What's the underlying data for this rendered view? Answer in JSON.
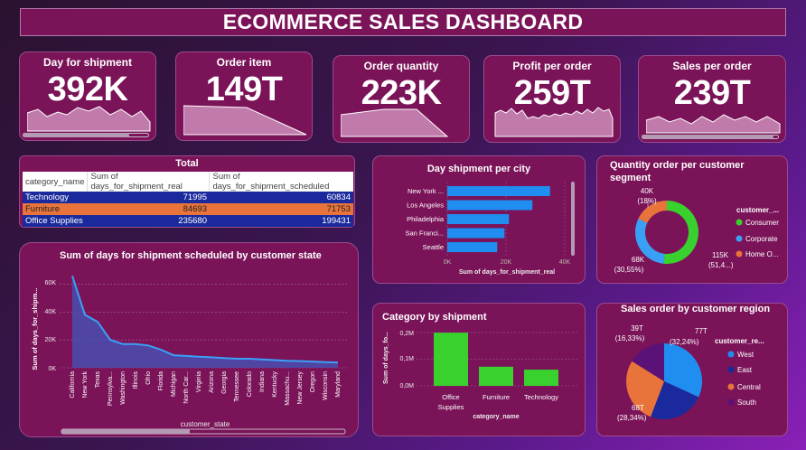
{
  "dashboard": {
    "title": "ECOMMERCE SALES DASHBOARD"
  },
  "kpis": [
    {
      "label": "Day for shipment",
      "value": "392K"
    },
    {
      "label": "Order item",
      "value": "149T"
    },
    {
      "label": "Order quantity",
      "value": "223K"
    },
    {
      "label": "Profit per order",
      "value": "259T"
    },
    {
      "label": "Sales per order",
      "value": "239T"
    }
  ],
  "table": {
    "title": "Total",
    "headers": [
      "category_name",
      "Sum of days_for_shipment_real",
      "Sum of days_for_shipment_scheduled"
    ],
    "rows": [
      {
        "category": "Technology",
        "real": "71995",
        "scheduled": "60834",
        "color": "#1a2a9c"
      },
      {
        "category": "Furniture",
        "real": "84693",
        "scheduled": "71753",
        "color": "#e8743b"
      },
      {
        "category": "Office Supplies",
        "real": "235680",
        "scheduled": "199431",
        "color": "#1a2a9c"
      }
    ]
  },
  "day_shipment_city": {
    "title": "Day shipment per city",
    "ylabel": "customer_city",
    "xlabel": "Sum of days_for_shipment_real",
    "x_ticks": [
      "0K",
      "20K",
      "40K"
    ]
  },
  "segment_donut": {
    "title_line1": "Quantity order per customer",
    "title_line2": "segment",
    "legend_title": "customer_...",
    "labels": {
      "top": "40K",
      "top_pct": "(18%)",
      "left": "68K",
      "left_pct": "(30,55%)",
      "right": "115K",
      "right_pct": "(51,4...)"
    },
    "legend": [
      {
        "name": "Consumer",
        "color": "#39d12e"
      },
      {
        "name": "Corporate",
        "color": "#3aa0f5"
      },
      {
        "name": "Home O...",
        "color": "#e8743b"
      }
    ]
  },
  "state_chart": {
    "title": "Sum of days for shipment scheduled by customer state",
    "ylabel": "Sum of days_for_shipm...",
    "xlabel": "customer_state",
    "y_ticks": [
      "60K",
      "40K",
      "20K",
      "0K"
    ]
  },
  "category_shipment": {
    "title": "Category by shipment",
    "ylabel": "Sum of days_fo...",
    "xlabel": "category_name",
    "y_ticks": [
      "0,2M",
      "0,1M",
      "0,0M"
    ],
    "cat_labels": [
      "Office",
      "Supplies",
      "Furniture",
      "Technology"
    ]
  },
  "region_pie": {
    "title": "Sales order by customer region",
    "legend_title": "customer_re...",
    "labels": {
      "tl": "39T",
      "tl_pct": "(16,33%)",
      "tr": "77T",
      "tr_pct": "(32,24%)",
      "bl": "68T",
      "bl_pct": "(28,34%)"
    },
    "legend": [
      {
        "name": "West",
        "color": "#1f8ef0"
      },
      {
        "name": "East",
        "color": "#1a2a9c"
      },
      {
        "name": "Central",
        "color": "#e8743b"
      },
      {
        "name": "South",
        "color": "#5a1278"
      }
    ]
  },
  "chart_data": [
    {
      "type": "bar",
      "title": "Day shipment per city",
      "xlabel": "Sum of days_for_shipment_real",
      "ylabel": "customer_city",
      "categories": [
        "New York ...",
        "Los Angeles",
        "Philadelphia",
        "San Franci...",
        "Seattle"
      ],
      "values": [
        35000,
        29000,
        21000,
        19500,
        17000
      ],
      "xlim": [
        0,
        40000
      ]
    },
    {
      "type": "pie",
      "title": "Quantity order per customer segment",
      "categories": [
        "Consumer",
        "Corporate",
        "Home O..."
      ],
      "values": [
        115,
        68,
        40
      ],
      "percents": [
        51.4,
        30.55,
        18
      ]
    },
    {
      "type": "area",
      "title": "Sum of days for shipment scheduled by customer state",
      "xlabel": "customer_state",
      "ylabel": "Sum of days_for_shipm...",
      "categories": [
        "California",
        "New York",
        "Texas",
        "Pennsylva...",
        "Washington",
        "Illinois",
        "Ohio",
        "Florida",
        "Michigan",
        "North Car...",
        "Virginia",
        "Arizona",
        "Georgia",
        "Tennessee",
        "Colorado",
        "Indiana",
        "Kentucky",
        "Massachu...",
        "New Jersey",
        "Oregon",
        "Wisconsin",
        "Maryland"
      ],
      "values": [
        66000,
        38000,
        33000,
        20000,
        17000,
        17000,
        16000,
        13000,
        9000,
        8500,
        8000,
        7500,
        7000,
        6500,
        6500,
        6000,
        5500,
        5000,
        4800,
        4500,
        4000,
        3800
      ],
      "ylim": [
        0,
        70000
      ]
    },
    {
      "type": "bar",
      "title": "Category by shipment",
      "xlabel": "category_name",
      "ylabel": "Sum of days_fo...",
      "categories": [
        "Office Supplies",
        "Furniture",
        "Technology"
      ],
      "values": [
        199431,
        71753,
        60834
      ],
      "ylim": [
        0,
        200000
      ]
    },
    {
      "type": "pie",
      "title": "Sales order by customer region",
      "categories": [
        "West",
        "East",
        "Central",
        "South"
      ],
      "values": [
        77,
        58,
        68,
        39
      ],
      "percents": [
        32.24,
        23.09,
        28.34,
        16.33
      ]
    }
  ]
}
